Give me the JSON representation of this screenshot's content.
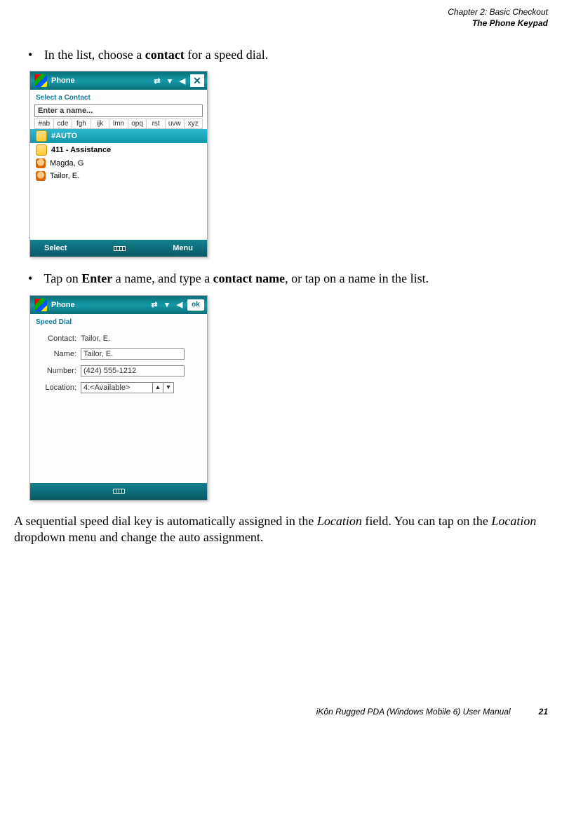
{
  "header": {
    "line1": "Chapter 2:  Basic Checkout",
    "line2": "The Phone Keypad"
  },
  "bullets": {
    "b1_pre": "In the list, choose a ",
    "b1_bold": "contact",
    "b1_post": " for a speed dial.",
    "b2_pre": "Tap on ",
    "b2_bold1": "Enter",
    "b2_mid": " a name, and type a ",
    "b2_bold2": "contact name",
    "b2_post": ", or tap on a name in the list."
  },
  "shot1": {
    "title": "Phone",
    "close": "✕",
    "subhead": "Select a Contact",
    "name_placeholder": "Enter a name...",
    "alpha": [
      "#ab",
      "cde",
      "fgh",
      "ijk",
      "lmn",
      "opq",
      "rst",
      "uvw",
      "xyz"
    ],
    "rows": {
      "r0": "#AUTO",
      "r1": "411 - Assistance",
      "r2": "Magda, G",
      "r3": "Tailor, E."
    },
    "bb_left": "Select",
    "bb_right": "Menu"
  },
  "shot2": {
    "title": "Phone",
    "ok": "ok",
    "subhead": "Speed Dial",
    "labels": {
      "contact": "Contact:",
      "name": "Name:",
      "number": "Number:",
      "location": "Location:"
    },
    "values": {
      "contact": "Tailor, E.",
      "name": "Tailor, E.",
      "number": "(424) 555-1212",
      "location": "4:<Available>"
    },
    "spin_up": "▲",
    "spin_down": "▼"
  },
  "para": {
    "t1": "A sequential speed dial key is automatically assigned in the ",
    "i1": "Location",
    "t2": " field. You can tap on the ",
    "i2": "Location",
    "t3": " dropdown menu and change the auto assignment."
  },
  "footer": {
    "text": "iKôn Rugged PDA (Windows Mobile 6) User Manual",
    "page": "21"
  }
}
